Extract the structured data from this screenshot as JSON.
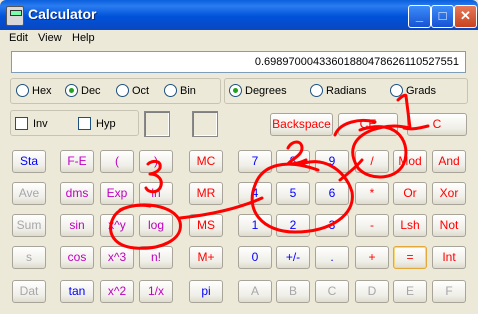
{
  "window": {
    "title": "Calculator",
    "controls": {
      "minimize": "_",
      "maximize": "□",
      "close": "✕"
    }
  },
  "menu": {
    "items": [
      "Edit",
      "View",
      "Help"
    ]
  },
  "display": {
    "value": "0.69897000433601880478626110527551"
  },
  "base": {
    "options": [
      "Hex",
      "Dec",
      "Oct",
      "Bin"
    ],
    "selected": "Dec"
  },
  "angle": {
    "options": [
      "Degrees",
      "Radians",
      "Grads"
    ],
    "selected": "Degrees"
  },
  "modifiers": {
    "inv": "Inv",
    "hyp": "Hyp"
  },
  "top_keys": {
    "backspace": "Backspace",
    "ce": "CE",
    "c": "C"
  },
  "keys": {
    "sta": "Sta",
    "fe": "F-E",
    "lparen": "(",
    "rparen": ")",
    "mc": "MC",
    "d7": "7",
    "d8": "8",
    "d9": "9",
    "div": "/",
    "mod": "Mod",
    "and": "And",
    "ave": "Ave",
    "dms": "dms",
    "exp": "Exp",
    "ln": "ln",
    "mr": "MR",
    "d4": "4",
    "d5": "5",
    "d6": "6",
    "mul": "*",
    "or": "Or",
    "xor": "Xor",
    "sum": "Sum",
    "sin": "sin",
    "xy": "x^y",
    "log": "log",
    "ms": "MS",
    "d1": "1",
    "d2": "2",
    "d3": "3",
    "sub": "-",
    "lsh": "Lsh",
    "not": "Not",
    "s": "s",
    "cos": "cos",
    "x3": "x^3",
    "fact": "n!",
    "mplus": "M+",
    "d0": "0",
    "sign": "+/-",
    "dot": ".",
    "add": "+",
    "eq": "=",
    "int": "Int",
    "dat": "Dat",
    "tan": "tan",
    "x2": "x^2",
    "recip": "1/x",
    "pi": "pi",
    "a": "A",
    "b": "B",
    "c": "C",
    "d": "D",
    "e": "E",
    "f": "F"
  },
  "annotations": {
    "n1": "1",
    "n2": "2",
    "n3": "3",
    "color": "#ff0000"
  }
}
